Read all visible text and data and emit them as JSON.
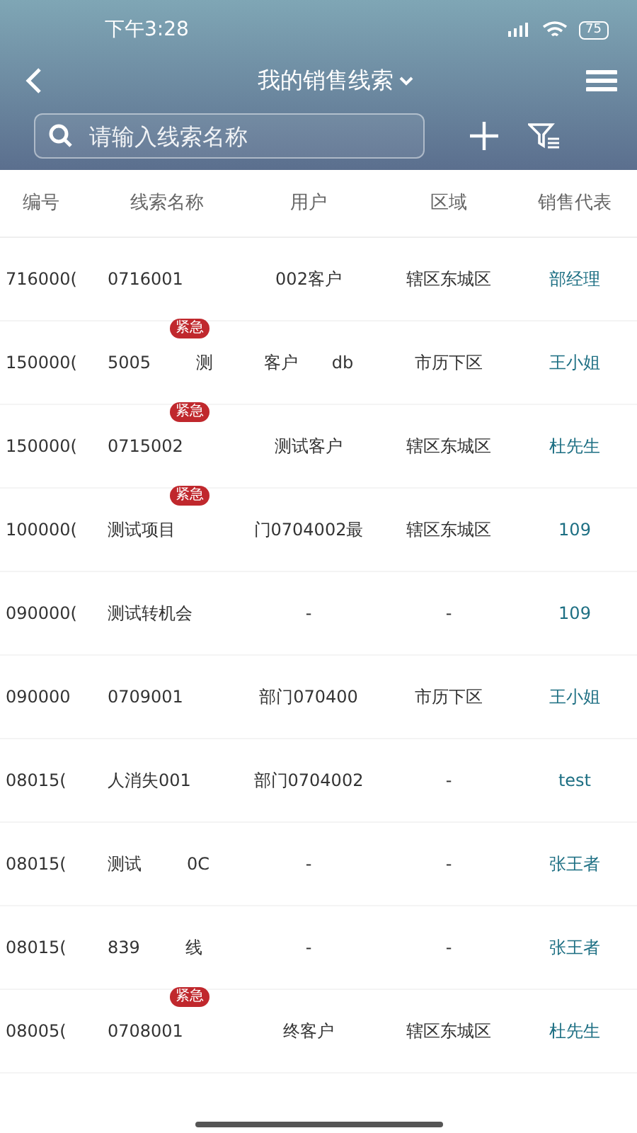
{
  "status_bar": {
    "time": "下午3:28",
    "battery": "75"
  },
  "nav": {
    "title": "我的销售线索",
    "search": {
      "placeholder": "请输入线索名称"
    }
  },
  "table": {
    "columns": [
      "编号",
      "线索名称",
      "用户",
      "区域",
      "销售代表"
    ],
    "rows": [
      {
        "id": "716000(",
        "name": [
          "0716001"
        ],
        "user": [
          "002客户"
        ],
        "area": "辖区东城区",
        "rep": "部经理"
      },
      {
        "id": "150000(",
        "name": [
          "5005",
          "测"
        ],
        "badge": "紧急",
        "user": [
          "客户",
          "db"
        ],
        "area": "市历下区",
        "rep": "王小姐"
      },
      {
        "id": "150000(",
        "name": [
          "0715002"
        ],
        "badge": "紧急",
        "user": [
          "测试客户"
        ],
        "area": "辖区东城区",
        "rep": "杜先生"
      },
      {
        "id": "100000(",
        "name": [
          "测试项目"
        ],
        "badge": "紧急",
        "user": [
          "门0704002最"
        ],
        "area": "辖区东城区",
        "rep": "109"
      },
      {
        "id": "090000(",
        "name": [
          "测试转机会"
        ],
        "user": [
          "-"
        ],
        "area": "-",
        "rep": "109"
      },
      {
        "id": "090000",
        "name": [
          "0709001"
        ],
        "user": [
          "部门070400"
        ],
        "area": "市历下区",
        "rep": "王小姐"
      },
      {
        "id": "08015(",
        "name": [
          "人消失001"
        ],
        "user": [
          "部门0704002"
        ],
        "area": "-",
        "rep": "test"
      },
      {
        "id": "08015(",
        "name": [
          "测试",
          "0C"
        ],
        "user": [
          "-"
        ],
        "area": "-",
        "rep": "张王者"
      },
      {
        "id": "08015(",
        "name": [
          "839",
          "线"
        ],
        "user": [
          "-"
        ],
        "area": "-",
        "rep": "张王者"
      },
      {
        "id": "08005(",
        "name": [
          "0708001"
        ],
        "badge": "紧急",
        "user": [
          "终客户"
        ],
        "area": "辖区东城区",
        "rep": "杜先生"
      }
    ]
  }
}
